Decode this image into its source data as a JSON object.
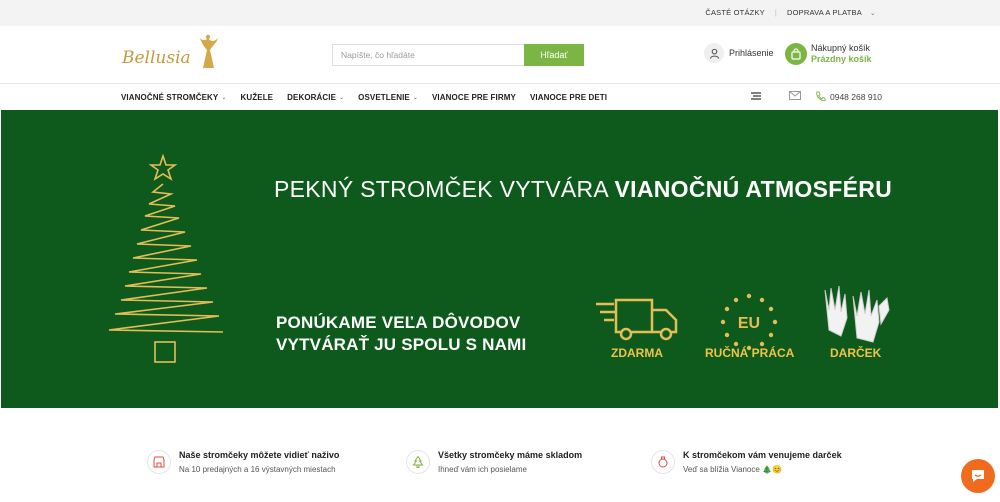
{
  "topbar": {
    "faq": "ČASTÉ OTÁZKY",
    "separator": "|",
    "shipping": "DOPRAVA A PLATBA"
  },
  "header": {
    "logo_text": "Bellusia",
    "search_placeholder": "Napíšte, čo hľadáte",
    "search_button": "Hľadať",
    "login_label": "Prihlásenie",
    "cart_title": "Nákupný košík",
    "cart_status": "Prázdny košík"
  },
  "nav": {
    "items": [
      {
        "label": "VIANOČNÉ STROMČEKY",
        "dropdown": true
      },
      {
        "label": "KUŽELE",
        "dropdown": false
      },
      {
        "label": "DEKORÁCIE",
        "dropdown": true
      },
      {
        "label": "OSVETLENIE",
        "dropdown": true
      },
      {
        "label": "VIANOCE PRE FIRMY",
        "dropdown": false
      },
      {
        "label": "VIANOCE PRE DETI",
        "dropdown": false
      }
    ],
    "phone": "0948 268 910"
  },
  "banner": {
    "headline_plain": "PEKNÝ STROMČEK VYTVÁRA ",
    "headline_bold": "VIANOČNÚ ATMOSFÉRU",
    "sub_line1": "PONÚKAME VEĽA DÔVODOV",
    "sub_line2": "VYTVÁRAŤ JU SPOLU S NAMI",
    "eu_text": "EU",
    "features": [
      "ZDARMA",
      "RUČNÁ PRÁCA",
      "DARČEK"
    ],
    "colors": {
      "background": "#0e5a1c",
      "accent": "#f0c24a"
    }
  },
  "benefits": [
    {
      "title": "Naše stromčeky môžete vidieť naživo",
      "subtitle": "Na 10 predajných a 16 výstavných miestach"
    },
    {
      "title": "Všetky stromčeky máme skladom",
      "subtitle": "Ihneď vám ich posielame"
    },
    {
      "title": "K stromčekom vám venujeme darček",
      "subtitle": "Veď sa blížia Vianoce 🎄😊"
    }
  ],
  "icons": {
    "login": "user-icon",
    "cart": "shopping-bag-icon",
    "menu": "hamburger-icon",
    "mail": "mail-icon",
    "phone": "phone-icon",
    "chat": "chat-icon"
  },
  "theme": {
    "green": "#7bb543",
    "chat": "#f06b1e"
  }
}
